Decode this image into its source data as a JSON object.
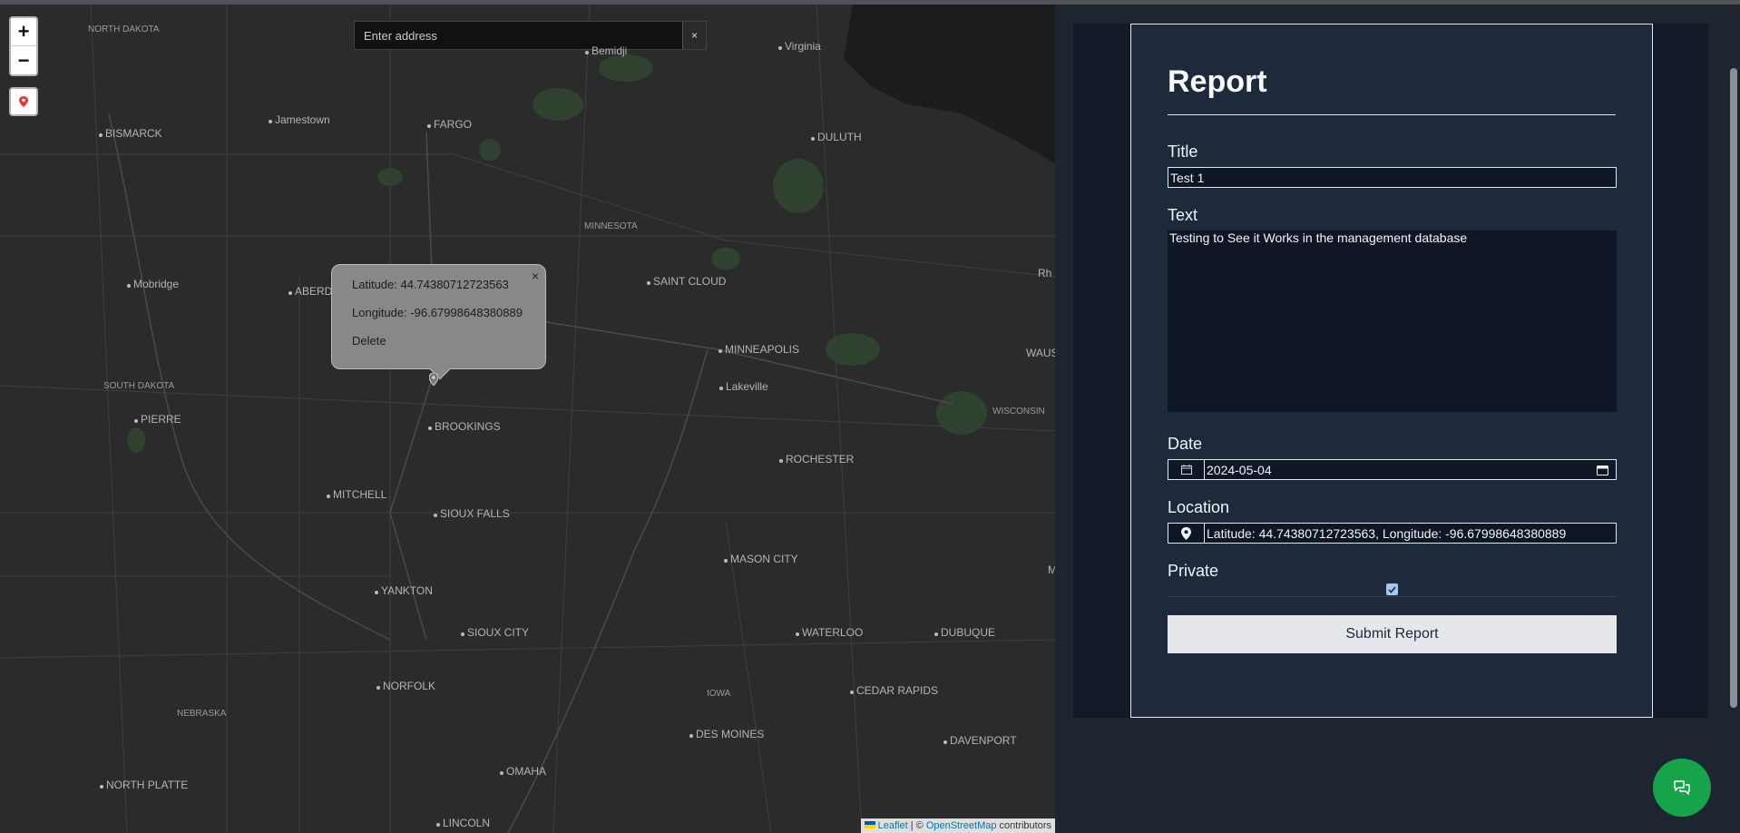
{
  "map": {
    "zoom_in": "+",
    "zoom_out": "−",
    "search_placeholder": "Enter address",
    "search_clear": "×",
    "labels": [
      {
        "text": "NORTH DAKOTA",
        "small": true
      },
      {
        "text": "Bemidji"
      },
      {
        "text": "Virginia"
      },
      {
        "text": "Jamestown"
      },
      {
        "text": "BISMARCK"
      },
      {
        "text": "FARGO"
      },
      {
        "text": "DULUTH"
      },
      {
        "text": "MINNESOTA",
        "small": true
      },
      {
        "text": "Mobridge"
      },
      {
        "text": "ABERDE"
      },
      {
        "text": "SAINT CLOUD"
      },
      {
        "text": "MINNEAPOLIS"
      },
      {
        "text": "Lakeville"
      },
      {
        "text": "SOUTH DAKOTA",
        "small": true
      },
      {
        "text": "PIERRE"
      },
      {
        "text": "BROOKINGS"
      },
      {
        "text": "ROCHESTER"
      },
      {
        "text": "WISCONSIN",
        "small": true
      },
      {
        "text": "MITCHELL"
      },
      {
        "text": "SIOUX FALLS"
      },
      {
        "text": "MASON CITY"
      },
      {
        "text": "YANKTON"
      },
      {
        "text": "SIOUX CITY"
      },
      {
        "text": "WATERLOO"
      },
      {
        "text": "DUBUQUE"
      },
      {
        "text": "IOWA",
        "small": true
      },
      {
        "text": "NORFOLK"
      },
      {
        "text": "CEDAR RAPIDS"
      },
      {
        "text": "NEBRASKA",
        "small": true
      },
      {
        "text": "DES MOINES"
      },
      {
        "text": "DAVENPORT"
      },
      {
        "text": "OMAHA"
      },
      {
        "text": "NORTH PLATTE"
      },
      {
        "text": "LINCOLN"
      },
      {
        "text": "WAUS"
      },
      {
        "text": "Rh"
      },
      {
        "text": "M"
      }
    ],
    "popup": {
      "latitude": "Latitude: 44.74380712723563",
      "longitude": "Longitude: -96.67998648380889",
      "delete": "Delete",
      "close": "×"
    },
    "attribution": {
      "leaflet": "Leaflet",
      "sep": " | © ",
      "osm": "OpenStreetMap",
      "contributors": " contributors"
    }
  },
  "form": {
    "heading": "Report",
    "title_label": "Title",
    "title_value": "Test 1",
    "text_label": "Text",
    "text_value": "Testing to See it Works in the management database",
    "date_label": "Date",
    "date_value": "2024-05-04",
    "location_label": "Location",
    "location_value": "Latitude: 44.74380712723563, Longitude: -96.67998648380889",
    "private_label": "Private",
    "private_checked": true,
    "submit_label": "Submit Report"
  },
  "colors": {
    "accent_green": "#16a34a",
    "panel_bg": "#1e293b",
    "map_bg": "#2b2b2c"
  }
}
